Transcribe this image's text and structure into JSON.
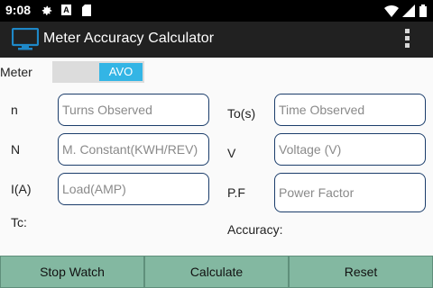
{
  "status_bar": {
    "time": "9:08",
    "icons": [
      "gear-icon",
      "a-icon",
      "sd-card-icon",
      "wifi-icon",
      "signal-icon",
      "battery-icon"
    ],
    "a_icon_text": "A"
  },
  "app_bar": {
    "title": "Meter Accuracy Calculator",
    "icon": "monitor-icon",
    "accent": "#1e88c8",
    "background": "#212121"
  },
  "meter": {
    "label": "Meter",
    "toggle_value": "AVO",
    "toggle_color": "#33b5e5"
  },
  "fields": {
    "turns": {
      "label": "n",
      "placeholder": "Turns Observed"
    },
    "time": {
      "label": "To(s)",
      "placeholder": "Time Observed"
    },
    "constant": {
      "label": "N",
      "placeholder": "M. Constant(KWH/REV)"
    },
    "voltage": {
      "label": "V",
      "placeholder": "Voltage (V)"
    },
    "load": {
      "label": "I(A)",
      "placeholder": "Load(AMP)"
    },
    "power_factor": {
      "label": "P.F",
      "placeholder": "Power Factor"
    }
  },
  "results": {
    "tc_label": "Tc:",
    "accuracy_label": "Accuracy:"
  },
  "buttons": {
    "stop_watch": "Stop Watch",
    "calculate": "Calculate",
    "reset": "Reset",
    "color": "#83b8a1"
  }
}
